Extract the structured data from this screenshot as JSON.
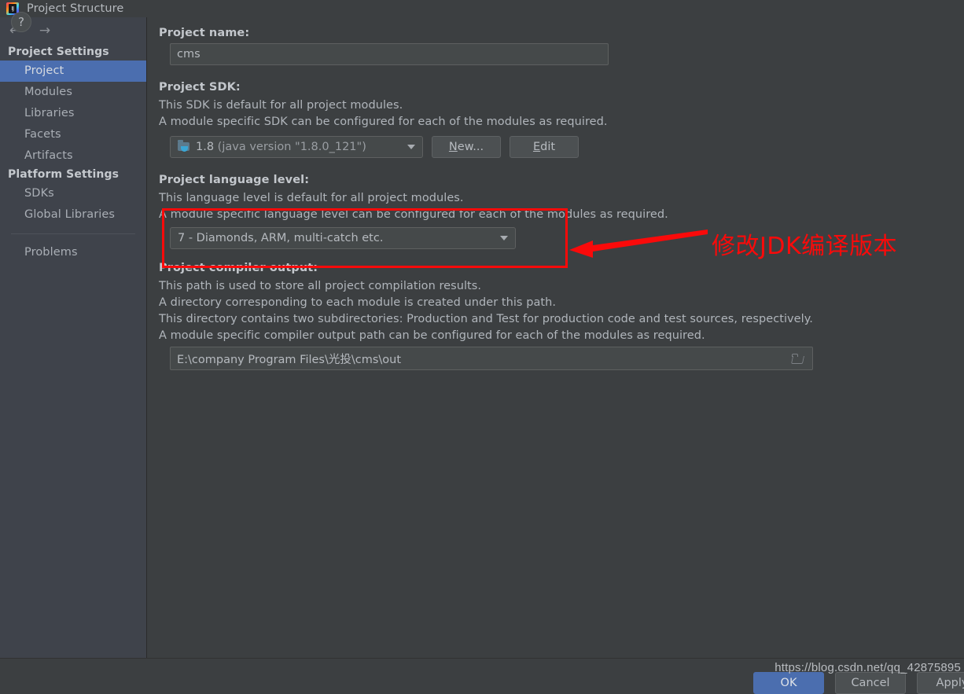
{
  "window": {
    "title": "Project Structure",
    "icon": "intellij-idea-logo-icon"
  },
  "sidebar": {
    "back_icon": "arrow-left-icon",
    "forward_icon": "arrow-right-icon",
    "groups": [
      {
        "header": "Project Settings",
        "items": [
          "Project",
          "Modules",
          "Libraries",
          "Facets",
          "Artifacts"
        ]
      },
      {
        "header": "Platform Settings",
        "items": [
          "SDKs",
          "Global Libraries"
        ]
      }
    ],
    "extra_items": [
      "Problems"
    ],
    "selected": "Project"
  },
  "main": {
    "project_name": {
      "label": "Project name:",
      "value": "cms"
    },
    "project_sdk": {
      "label": "Project SDK:",
      "descriptions": [
        "This SDK is default for all project modules.",
        "A module specific SDK can be configured for each of the modules as required."
      ],
      "selected_version": "1.8",
      "selected_detail": "(java version \"1.8.0_121\")",
      "sdk_icon": "java-sdk-folder-icon",
      "new_button": "New...",
      "new_button_mnemonic": "N",
      "new_button_rest": "ew...",
      "edit_button": "Edit",
      "edit_button_mnemonic": "E",
      "edit_button_rest": "dit"
    },
    "language_level": {
      "label": "Project language level:",
      "descriptions": [
        "This language level is default for all project modules.",
        "A module specific language level can be configured for each of the modules as required."
      ],
      "selected": "7 - Diamonds, ARM, multi-catch etc."
    },
    "compiler_output": {
      "label": "Project compiler output:",
      "descriptions": [
        "This path is used to store all project compilation results.",
        "A directory corresponding to each module is created under this path.",
        "This directory contains two subdirectories: Production and Test for production code and test sources, respectively.",
        "A module specific compiler output path can be configured for each of the modules as required."
      ],
      "path": "E:\\company Program Files\\光投\\cms\\out",
      "browse_icon": "browse-folder-icon"
    }
  },
  "annotation": {
    "text": "修改JDK编译版本",
    "color": "#fa0a0a",
    "highlight_target": "project-language-level-combo"
  },
  "footer": {
    "help_label": "?",
    "ok_label": "OK",
    "cancel_label": "Cancel",
    "apply_label": "Apply"
  },
  "watermark": {
    "text": "https://blog.csdn.net/qq_42875895"
  }
}
